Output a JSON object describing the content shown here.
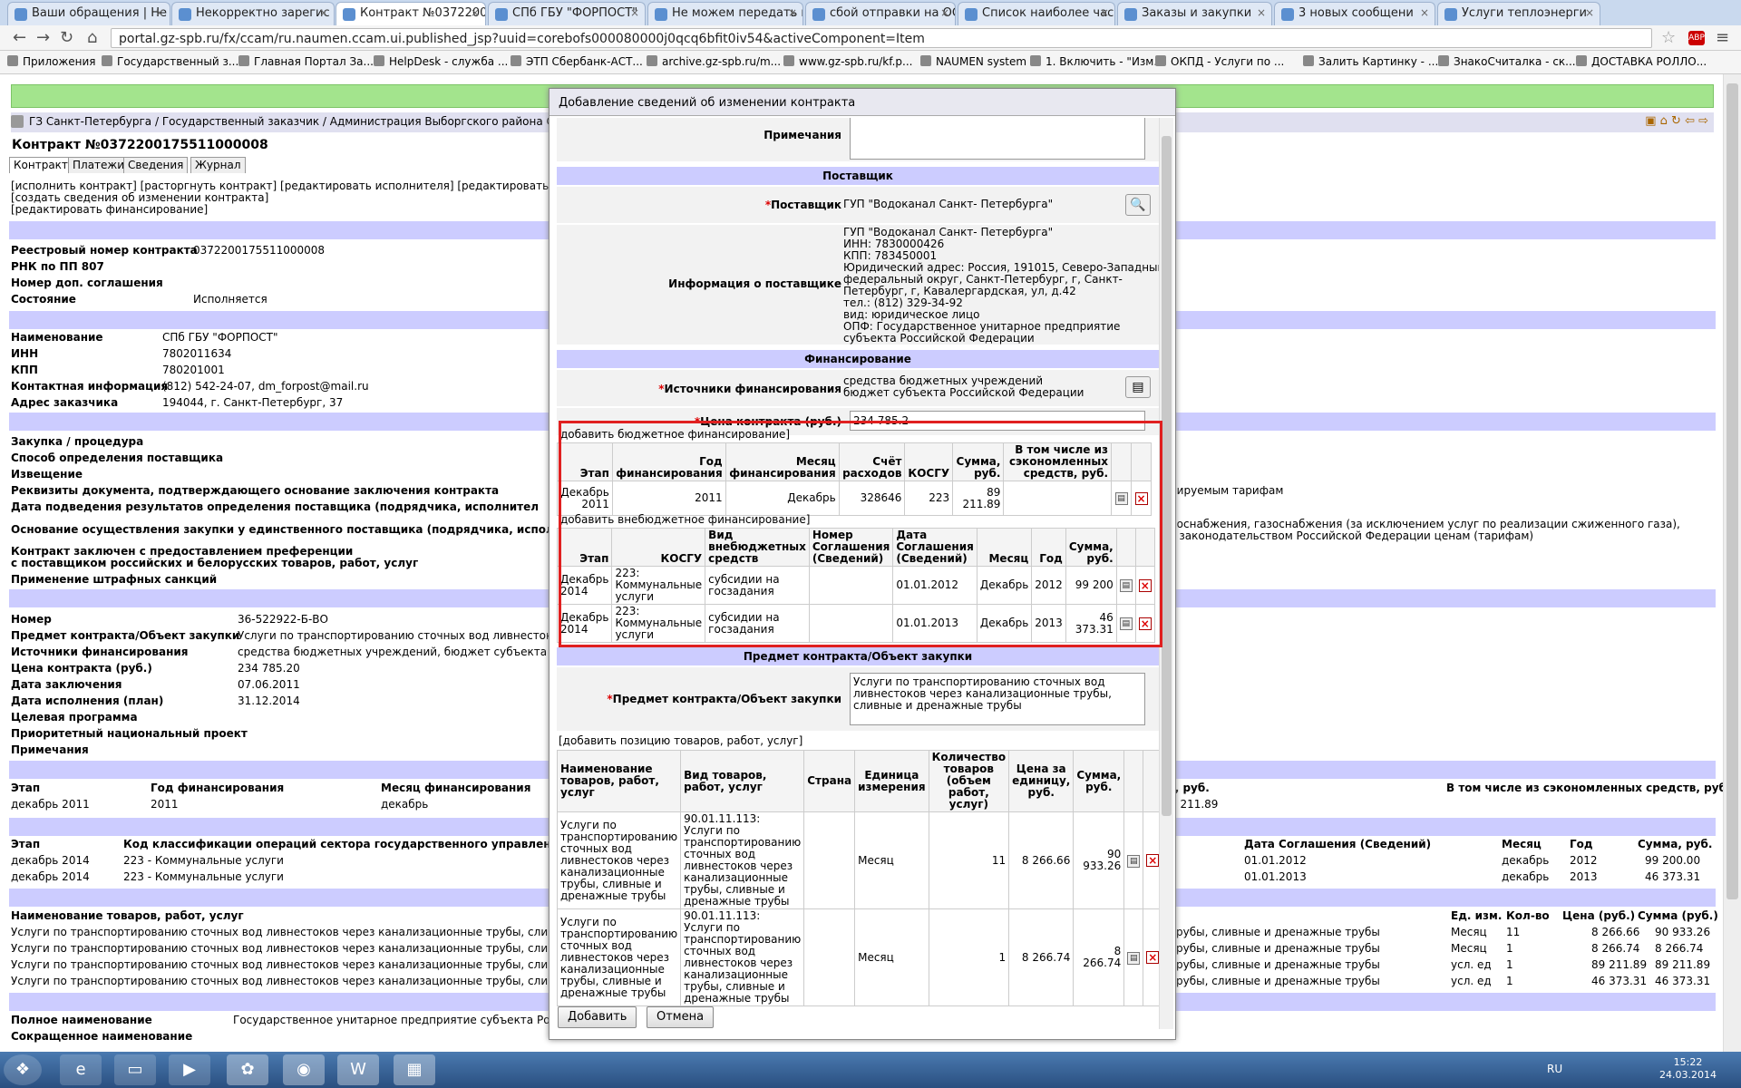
{
  "browser": {
    "tabs": [
      "Ваши обращения | Не",
      "Некорректно зарегис",
      "Контракт №037220017",
      "СПб ГБУ \"ФОРПОСТ\"",
      "Не можем передать и",
      "сбой отправки на ОО",
      "Список наиболее час",
      "Заказы и закупки",
      "3 новых сообщени",
      "Услуги теплоэнерги"
    ],
    "url": "portal.gz-spb.ru/fx/ccam/ru.naumen.ccam.ui.published_jsp?uuid=corebofs000080000j0qcq6bfit0iv54&activeComponent=Item",
    "bookmarks": [
      "Приложения",
      "Государственный з...",
      "Главная Портал За...",
      "HelpDesk - служба ...",
      "ЭТП Сбербанк-АСТ...",
      "archive.gz-spb.ru/m...",
      "www.gz-spb.ru/kf.p...",
      "NAUMEN system",
      "1. Включить - \"Изм...",
      "ОКПД - Услуги по ...",
      "Залить Картинку - ...",
      "ЗнакоСчиталка - ск...",
      "ДОСТАВКА РОЛЛО..."
    ]
  },
  "page": {
    "breadcrumb": "ГЗ Санкт-Петербурга / Государственный заказчик / Администрация Выборгского района Санкт-",
    "title": "Контракт №0372200175511000008",
    "tabs": [
      "Контракт",
      "Платежи",
      "Сведения",
      "Журнал"
    ],
    "actions": [
      "[исполнить контракт] [расторгнуть контракт] [редактировать исполнителя] [редактировать сведени",
      "[создать сведения об изменении контракта]",
      "[редактировать финансирование]"
    ],
    "info1": [
      {
        "label": "Реестровый номер контракта",
        "value": "0372200175511000008"
      },
      {
        "label": "РНК по ПП 807",
        "value": ""
      },
      {
        "label": "Номер доп. соглашения",
        "value": ""
      },
      {
        "label": "Состояние",
        "value": "Исполняется"
      }
    ],
    "info2": [
      {
        "label": "Наименование",
        "value": "СПб ГБУ \"ФОРПОСТ\""
      },
      {
        "label": "ИНН",
        "value": "7802011634"
      },
      {
        "label": "КПП",
        "value": "780201001"
      },
      {
        "label": "Контактная информация",
        "value": "(812) 542-24-07, dm_forpost@mail.ru"
      },
      {
        "label": "Адрес заказчика",
        "value": "194044, г. Санкт-Петербург, 37"
      }
    ],
    "info3": [
      "Закупка / процедура",
      "Способ определения поставщика",
      "Извещение",
      "Реквизиты документа, подтверждающего основание заключения контракта",
      "Дата подведения результатов определения поставщика (подрядчика, исполнител",
      "Основание осуществления закупки у единственного поставщика (подрядчика, исполнит",
      "Контракт заключен с предоставлением преференции",
      "с поставщиком российских и белорусских товаров, работ, услуг",
      "Применение штрафных санкций"
    ],
    "right_texts": [
      "лируемым тарифам",
      "лоснабжения, газоснабжения (за исключением услуг по реализации сжиженного газа),",
      "с законодательством Российской Федерации ценам (тарифам)"
    ],
    "info4": [
      {
        "label": "Номер",
        "value": "36-522922-Б-ВО"
      },
      {
        "label": "Предмет контракта/Объект закупки",
        "value": "Услуги по транспортированию сточных вод ливнестоков с"
      },
      {
        "label": "Источники финансирования",
        "value": "средства бюджетных учреждений, бюджет субъекта Рос"
      },
      {
        "label": "Цена контракта (руб.)",
        "value": "234 785.20"
      },
      {
        "label": "Дата заключения",
        "value": "07.06.2011"
      },
      {
        "label": "Дата исполнения (план)",
        "value": "31.12.2014"
      },
      {
        "label": "Целевая программа",
        "value": ""
      },
      {
        "label": "Приоритетный национальный проект",
        "value": ""
      },
      {
        "label": "Примечания",
        "value": ""
      }
    ],
    "fin_header": {
      "stage": "Этап",
      "year": "Год финансирования",
      "month": "Месяц финансирования",
      "right": "В том числе из сэкономленных средств, руб.",
      "r_sum": "211.89"
    },
    "fin_row": {
      "stage": "декабрь 2011",
      "year": "2011",
      "month": "декабрь",
      "r_sum": "9 211.89",
      "rsum_label": "я, руб."
    },
    "ext_header": {
      "stage": "Этап",
      "code": "Код классификации операций сектора государственного управления",
      "date": "Дата Соглашения (Сведений)",
      "month": "Месяц",
      "year": "Год",
      "sum": "Сумма, руб."
    },
    "ext_rows": [
      {
        "stage": "декабрь 2014",
        "code": "223 - Коммунальные услуги",
        "date": "01.01.2012",
        "month": "декабрь",
        "year": "2012",
        "sum": "99 200.00"
      },
      {
        "stage": "декабрь 2014",
        "code": "223 - Коммунальные услуги",
        "date": "01.01.2013",
        "month": "декабрь",
        "year": "2013",
        "sum": "46 373.31"
      }
    ],
    "goods_header": {
      "name": "Наименование товаров, работ, услуг",
      "unit": "Ед. изм.",
      "qty": "Кол-во",
      "price": "Цена (руб.)",
      "sum": "Сумма (руб.)"
    },
    "goods_rows": [
      {
        "name": "Услуги по транспортированию сточных вод ливнестоков через канализационные трубы, сливные и",
        "rname": "трубы, сливные и дренажные трубы",
        "unit": "Месяц",
        "qty": "11",
        "price": "8 266.66",
        "sum": "90 933.26"
      },
      {
        "name": "Услуги по транспортированию сточных вод ливнестоков через канализационные трубы, сливные и",
        "rname": "трубы, сливные и дренажные трубы",
        "unit": "Месяц",
        "qty": "1",
        "price": "8 266.74",
        "sum": "8 266.74"
      },
      {
        "name": "Услуги по транспортированию сточных вод ливнестоков через канализационные трубы, сливные и",
        "rname": "трубы, сливные и дренажные трубы",
        "unit": "усл. ед",
        "qty": "1",
        "price": "89 211.89",
        "sum": "89 211.89"
      },
      {
        "name": "Услуги по транспортированию сточных вод ливнестоков через канализационные трубы, сливные и",
        "rname": "трубы, сливные и дренажные трубы",
        "unit": "усл. ед",
        "qty": "1",
        "price": "46 373.31",
        "sum": "46 373.31"
      }
    ],
    "supplier": [
      {
        "label": "Полное наименование",
        "value": "Государственное унитарное предприятие субъекта Россий"
      },
      {
        "label": "Сокращенное наименование",
        "value": ""
      }
    ]
  },
  "dialog": {
    "title": "Добавление сведений об изменении контракта",
    "notes_label": "Примечания",
    "supplier_section": "Поставщик",
    "supplier_label": "Поставщик",
    "supplier_value": "ГУП \"Водоканал Санкт- Петербурга\"",
    "supplier_info_label": "Информация о поставщике",
    "supplier_info": "ГУП \"Водоканал Санкт- Петербурга\"\nИНН: 7830000426\nКПП: 783450001\nЮридический адрес: Россия, 191015, Северо-Западный\nфедеральный округ, Санкт-Петербург, г, Санкт-\nПетербург, г, Кавалергардская, ул, д.42\nтел.: (812) 329-34-92\nвид: юридическое лицо\nОПФ: Государственное унитарное предприятие\nсубъекта Российской Федерации",
    "fin_section": "Финансирование",
    "sources_label": "Источники финансирования",
    "sources_value": "средства бюджетных учреждений\nбюджет субъекта Российской Федерации",
    "price_label": "Цена контракта (руб.)",
    "price_value": "234 785.2",
    "add_budget": "добавить бюджетное финансирование]",
    "budget_cols": [
      "Этап",
      "Год финансирования",
      "Месяц финансирования",
      "Счёт расходов",
      "КОСГУ",
      "Сумма, руб.",
      "В том числе из сэкономленных средств, руб."
    ],
    "budget_rows": [
      {
        "stage": "Декабрь 2011",
        "year": "2011",
        "month": "Декабрь",
        "account": "328646",
        "kosgu": "223",
        "sum": "89 211.89",
        "saved": ""
      }
    ],
    "add_ext": "добавить внебюджетное финансирование]",
    "ext_cols": [
      "Этап",
      "КОСГУ",
      "Вид внебюджетных средств",
      "Номер Соглашения (Сведений)",
      "Дата Соглашения (Сведений)",
      "Месяц",
      "Год",
      "Сумма, руб."
    ],
    "ext_rows": [
      {
        "stage": "Декабрь 2014",
        "kosgu": "223: Коммунальные услуги",
        "kind": "субсидии на госзадания",
        "num": "",
        "date": "01.01.2012",
        "month": "Декабрь",
        "year": "2012",
        "sum": "99 200"
      },
      {
        "stage": "Декабрь 2014",
        "kosgu": "223: Коммунальные услуги",
        "kind": "субсидии на госзадания",
        "num": "",
        "date": "01.01.2013",
        "month": "Декабрь",
        "year": "2013",
        "sum": "46 373.31"
      }
    ],
    "subject_section": "Предмет контракта/Объект закупки",
    "subject_label": "Предмет контракта/Объект закупки",
    "subject_value": "Услуги по транспортированию сточных вод ливнестоков через канализационные трубы, сливные и дренажные трубы",
    "add_goods": "[добавить позицию товаров, работ, услуг]",
    "goods_cols": [
      "Наименование товаров, работ, услуг",
      "Вид товаров, работ, услуг",
      "Страна",
      "Единица измерения",
      "Количество товаров (объем работ, услуг)",
      "Цена за единицу, руб.",
      "Сумма, руб."
    ],
    "goods_rows": [
      {
        "name": "Услуги по транспортированию сточных вод ливнестоков через канализационные трубы, сливные и дренажные трубы",
        "kind": "90.01.11.113: Услуги по транспортированию сточных вод ливнестоков через канализационные трубы, сливные и дренажные трубы",
        "country": "",
        "unit": "Месяц",
        "qty": "11",
        "price": "8 266.66",
        "sum": "90 933.26"
      },
      {
        "name": "Услуги по транспортированию сточных вод ливнестоков через канализационные трубы, сливные и дренажные трубы",
        "kind": "90.01.11.113: Услуги по транспортированию сточных вод ливнестоков через канализационные трубы, сливные и дренажные трубы",
        "country": "",
        "unit": "Месяц",
        "qty": "1",
        "price": "8 266.74",
        "sum": "8 266.74"
      }
    ],
    "add_button": "Добавить",
    "cancel_button": "Отмена"
  },
  "taskbar": {
    "lang": "RU",
    "time": "15:22",
    "date": "24.03.2014"
  }
}
